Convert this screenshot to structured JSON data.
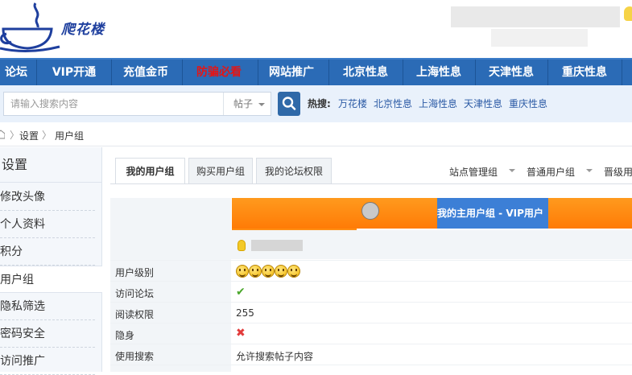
{
  "header": {
    "logo_text": "爬花楼",
    "colors": {
      "brand": "#1e3f9e",
      "nav_bg": "#2b6bb6",
      "hot_nav": "#e41515"
    }
  },
  "nav": {
    "items": [
      {
        "label": "论坛"
      },
      {
        "label": "VIP开通"
      },
      {
        "label": "充值金币"
      },
      {
        "label": "防骗必看"
      },
      {
        "label": "网站推广"
      },
      {
        "label": "北京性息"
      },
      {
        "label": "上海性息"
      },
      {
        "label": "天津性息"
      },
      {
        "label": "重庆性息"
      }
    ]
  },
  "search": {
    "placeholder": "请输入搜索内容",
    "type": "帖子",
    "icon": "search-icon",
    "hot_label": "热搜:",
    "hot_links": [
      "万花楼",
      "北京性息",
      "上海性息",
      "天津性息",
      "重庆性息"
    ]
  },
  "breadcrumb": {
    "items": [
      "设置",
      "用户组"
    ],
    "home_icon": "home-icon"
  },
  "sidebar": {
    "title": "设置",
    "items": [
      {
        "label": "修改头像"
      },
      {
        "label": "个人资料"
      },
      {
        "label": "积分"
      },
      {
        "label": "用户组"
      },
      {
        "label": "隐私筛选"
      },
      {
        "label": "密码安全"
      },
      {
        "label": "访问推广"
      }
    ],
    "active": "用户组"
  },
  "tabs": {
    "items": [
      {
        "label": "我的用户组"
      },
      {
        "label": "购买用户组"
      },
      {
        "label": "我的论坛权限"
      }
    ],
    "active": "我的用户组"
  },
  "group_dropdowns": [
    "站点管理组",
    "普通用户组",
    "晋级用户组"
  ],
  "group_table": {
    "current_group_label": "我的主用户组 - VIP用户",
    "rows": [
      {
        "label": "用户级别",
        "value": "",
        "icon": "smiley-icon"
      },
      {
        "label": "访问论坛",
        "value": "",
        "icon": "check-icon"
      },
      {
        "label": "阅读权限",
        "value": "255"
      },
      {
        "label": "隐身",
        "value": "",
        "icon": "x-icon"
      },
      {
        "label": "使用搜索",
        "value": "允许搜索帖子内容"
      }
    ]
  }
}
